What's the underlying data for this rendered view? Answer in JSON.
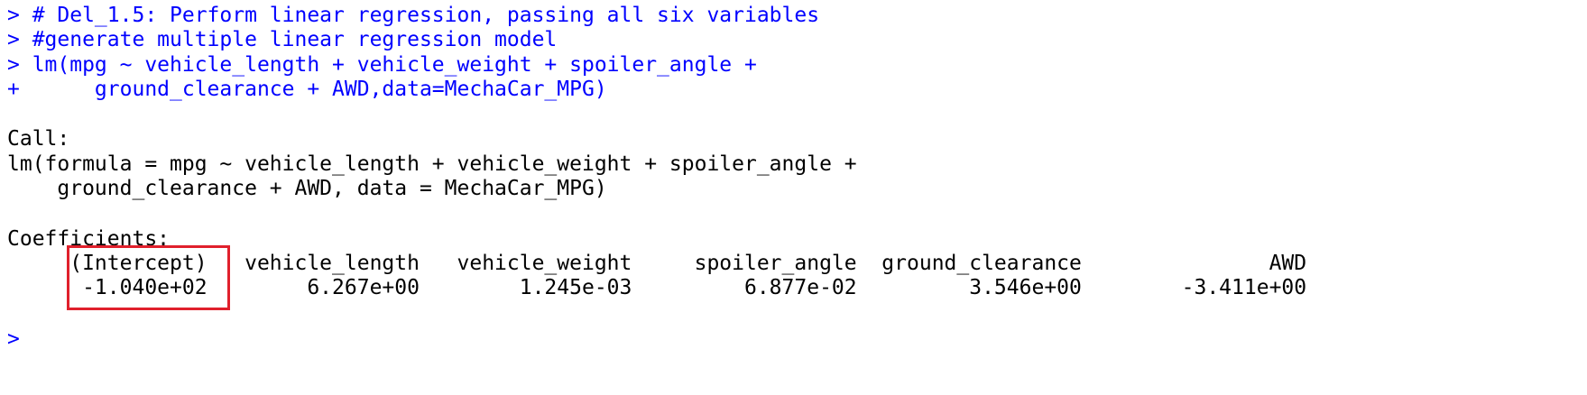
{
  "console": {
    "input_lines": [
      "> # Del_1.5: Perform linear regression, passing all six variables",
      "> #generate multiple linear regression model",
      "> lm(mpg ~ vehicle_length + vehicle_weight + spoiler_angle +",
      "+      ground_clearance + AWD,data=MechaCar_MPG)"
    ],
    "call_label": "Call:",
    "call_lines": [
      "lm(formula = mpg ~ vehicle_length + vehicle_weight + spoiler_angle +",
      "    ground_clearance + AWD, data = MechaCar_MPG)"
    ],
    "coefficients_label": "Coefficients:",
    "coef_header": "     (Intercept)   vehicle_length   vehicle_weight     spoiler_angle  ground_clearance               AWD",
    "coef_values": "      -1.040e+02        6.267e+00        1.245e-03         6.877e-02         3.546e+00        -3.411e+00",
    "prompt": ">"
  },
  "colors": {
    "input_text": "#0000ff",
    "output_text": "#000000",
    "highlight_border": "#e0202c"
  }
}
